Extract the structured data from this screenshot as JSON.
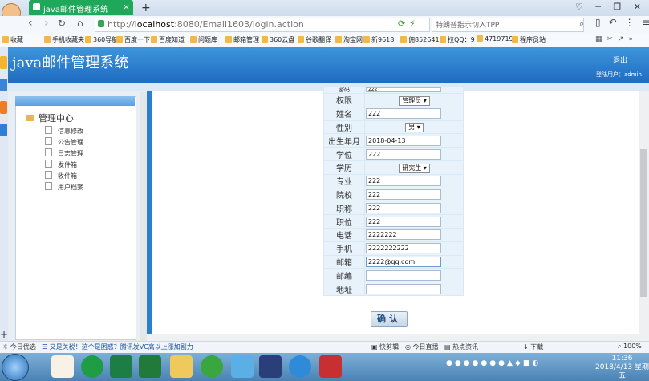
{
  "browser": {
    "tab_title": "java邮件管理系统",
    "tab_close": "×",
    "new_tab": "+",
    "window_controls": "♡ ─ ❐ ✕",
    "url_prefix": "http://",
    "url_host": "localhost",
    "url_rest": ":8080/Email1603/login.action",
    "search_placeholder": "特朗普指示切入TPP",
    "bookmarks": [
      "收藏",
      "手机收藏夹",
      "360导航",
      "百度一下",
      "百度知道",
      "问题库",
      "邮箱管理",
      "360云盘",
      "谷歌翻译",
      "淘宝网",
      "新9618",
      "佣852641",
      "拉QQ：9",
      "4719719",
      "程序员站"
    ]
  },
  "app": {
    "title": "java邮件管理系统",
    "logout": "退出",
    "user_info": "登陆用户：admin"
  },
  "sidebar": {
    "root": "管理中心",
    "items": [
      "信息修改",
      "公告管理",
      "日志管理",
      "发件箱",
      "收件箱",
      "用户档案"
    ]
  },
  "form": {
    "partial_label": "密码",
    "partial_value": "222",
    "rows": [
      {
        "label": "权限",
        "type": "select",
        "value": "管理员"
      },
      {
        "label": "姓名",
        "type": "input",
        "value": "222"
      },
      {
        "label": "性别",
        "type": "select",
        "value": "男"
      },
      {
        "label": "出生年月",
        "type": "input",
        "value": "2018-04-13"
      },
      {
        "label": "学位",
        "type": "input",
        "value": "222"
      },
      {
        "label": "学历",
        "type": "select",
        "value": "研究生"
      },
      {
        "label": "专业",
        "type": "input",
        "value": "222"
      },
      {
        "label": "院校",
        "type": "input",
        "value": "222"
      },
      {
        "label": "职称",
        "type": "input",
        "value": "222"
      },
      {
        "label": "职位",
        "type": "input",
        "value": "222"
      },
      {
        "label": "电话",
        "type": "input",
        "value": "2222222"
      },
      {
        "label": "手机",
        "type": "input",
        "value": "2222222222"
      },
      {
        "label": "邮箱",
        "type": "input",
        "value": "2222@qq.com"
      },
      {
        "label": "邮编",
        "type": "input",
        "value": ""
      },
      {
        "label": "地址",
        "type": "input",
        "value": ""
      }
    ],
    "submit": "确认"
  },
  "statusbar": {
    "left": "今日优选",
    "news": "又是关税！这个是困惑？腾讯发VC高以上涨加剧力",
    "items": [
      "快剪辑",
      "今日直播",
      "热点资讯",
      "下载",
      "100%"
    ]
  },
  "taskbar": {
    "time": "11:36",
    "date": "2018/4/13 星期五"
  }
}
